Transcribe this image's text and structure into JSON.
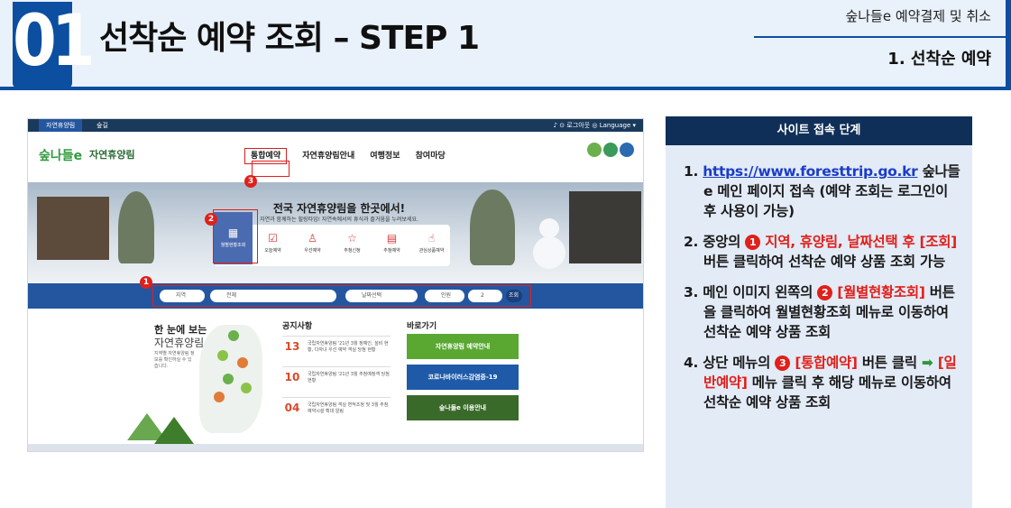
{
  "header": {
    "number": "01",
    "title": "선착순 예약 조회 – STEP 1",
    "category": "숲나들e 예약결제 및 취소",
    "subtitle": "1. 선착순 예약"
  },
  "screenshot": {
    "topbar": {
      "tab1": "자연휴양림",
      "tab2": "숲길",
      "right": "♪  ⊙ 로그아웃  ◎ Language ▾"
    },
    "logo": "숲나들e",
    "logo_sub": "자연휴양림",
    "menu": [
      "통합예약",
      "자연휴양림안내",
      "여행정보",
      "참여마당"
    ],
    "banner_title": "전국 자연휴양림을 한곳에서!",
    "banner_sub": "자연과 함께하는 힐링타임! 자연속에서의 휴식과 즐거움을 누려보세요.",
    "quick_items": [
      "월별현황조회",
      "오늘예약",
      "우선예약",
      "추첨신청",
      "추첨예약",
      "관심상품예약"
    ],
    "search_fields": [
      "지역",
      "전체",
      "날짜선택",
      "인원",
      "2",
      "조회"
    ],
    "map_title": "한 눈에 보는",
    "map_title2": "자연휴양림",
    "map_desc": "지역별 자연휴양림 정보를 확인하실 수 있습니다.",
    "notice_title": "공지사항",
    "notices": [
      {
        "day": "13",
        "date": "2021.01",
        "text": "국립자연휴양림 '21년 3월 정예인, 설비 현황, 다자녀 우선 예약 객실 당첨 현황"
      },
      {
        "day": "10",
        "date": "2021.01",
        "text": "국립자연휴양림 '21년 3월 추첨예정객 당첨 현황"
      },
      {
        "day": "04",
        "date": "2021.01",
        "text": "국립자연휴양림 객실 면적조정 및 3월 추첨예약시설 확대 알림"
      }
    ],
    "shortcut_title": "바로가기",
    "shortcuts": [
      "자연휴양림 예약안내",
      "코로나바이러스감염증-19",
      "숲나들e 이용안내"
    ],
    "markers": [
      "1",
      "2",
      "3"
    ]
  },
  "panel": {
    "heading": "사이트 접속 단계",
    "steps": [
      {
        "n": "1.",
        "link": "https://www.foresttrip.go.kr",
        "text": "숲나들e 메인 페이지 접속 (예약 조회는 로그인이 후 사용이 가능)"
      },
      {
        "n": "2.",
        "pre": "중앙의",
        "circle": "1",
        "red": "지역, 휴양림, 날짜선택 후 [조회]",
        "post": "버튼 클릭하여 선착순 예약 상품 조회 가능"
      },
      {
        "n": "3.",
        "pre": "메인 이미지 왼쪽의",
        "circle": "2",
        "red": "[월별현황조회]",
        "post": "버튼을 클릭하여 월별현황조회 메뉴로 이동하여 선착순 예약 상품 조회"
      },
      {
        "n": "4.",
        "pre": "상단 메뉴의",
        "circle": "3",
        "red": "[통합예약]",
        "mid": "버튼 클릭",
        "arrow": "➡",
        "red2": "[일반예약]",
        "post": "메뉴 클릭 후 해당 메뉴로 이동하여 선착순 예약 상품 조회"
      }
    ]
  },
  "colors": {
    "accent": "#0c4ea0",
    "panel_head": "#102f58",
    "panel_bg": "#e3ebf7",
    "highlight": "#e0201a",
    "link": "#1a3cc8"
  }
}
